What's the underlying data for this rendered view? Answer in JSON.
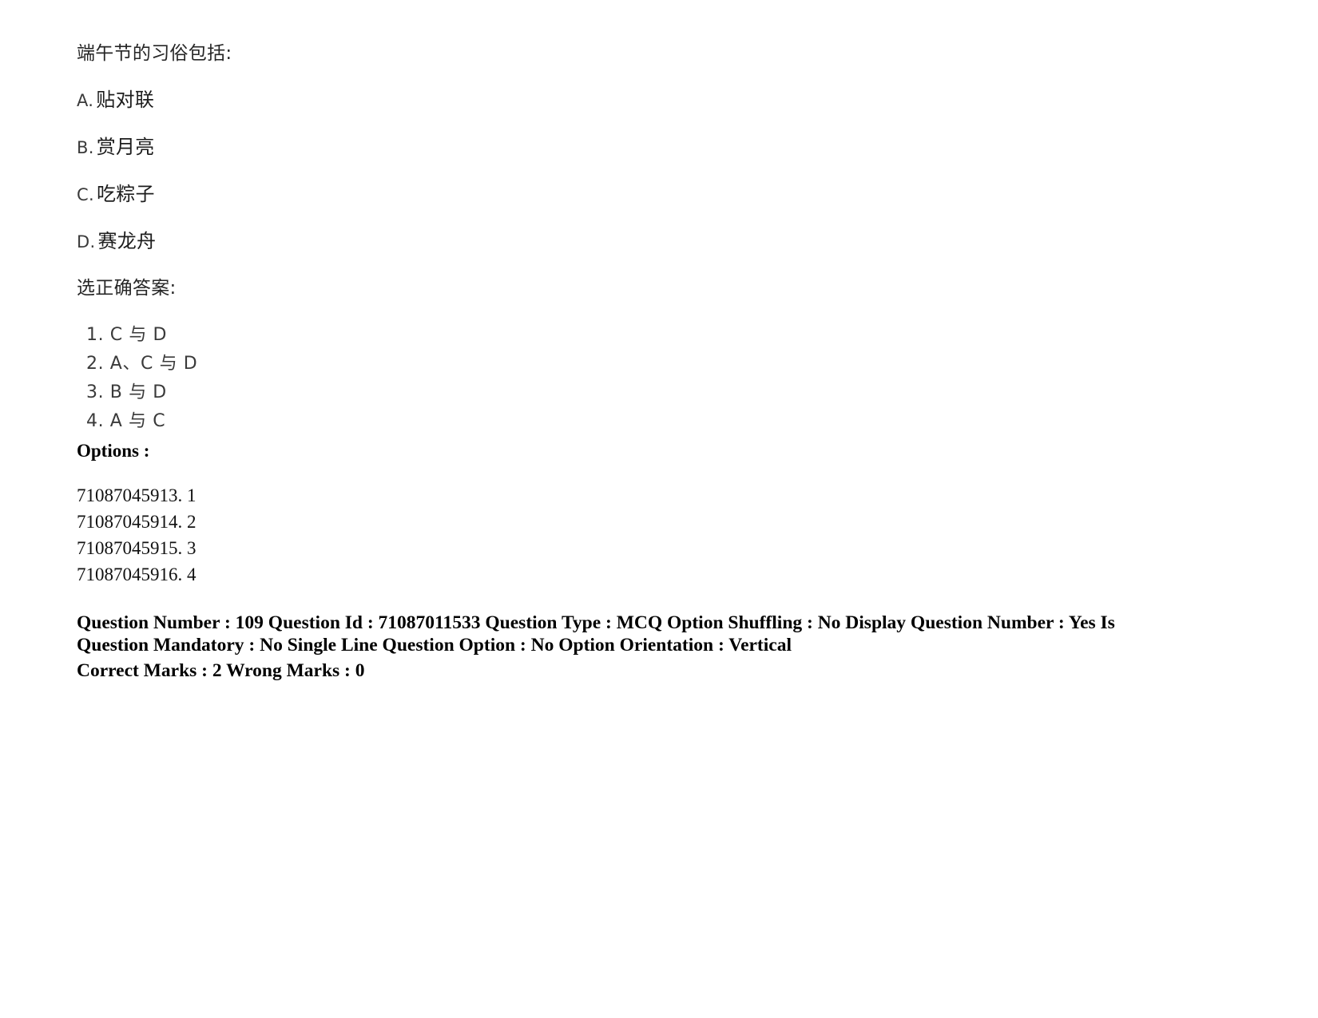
{
  "question": {
    "stem": "端午节的习俗包括:",
    "options": [
      {
        "letter": "A.",
        "text": "贴对联"
      },
      {
        "letter": "B.",
        "text": "赏月亮"
      },
      {
        "letter": "C.",
        "text": "吃粽子"
      },
      {
        "letter": "D.",
        "text": "赛龙舟"
      }
    ],
    "choose_prompt": "选正确答案:",
    "answers": [
      "1. C 与 D",
      "2. A、C 与 D",
      "3. B 与 D",
      "4. A 与 C"
    ]
  },
  "options_section": {
    "heading": "Options :",
    "items": [
      "71087045913. 1",
      "71087045914. 2",
      "71087045915. 3",
      "71087045916. 4"
    ]
  },
  "metadata": {
    "line1": "Question Number : 109 Question Id : 71087011533 Question Type : MCQ Option Shuffling : No Display Question Number : Yes Is Question Mandatory : No Single Line Question Option : No Option Orientation : Vertical",
    "line2": "Correct Marks : 2 Wrong Marks : 0"
  }
}
